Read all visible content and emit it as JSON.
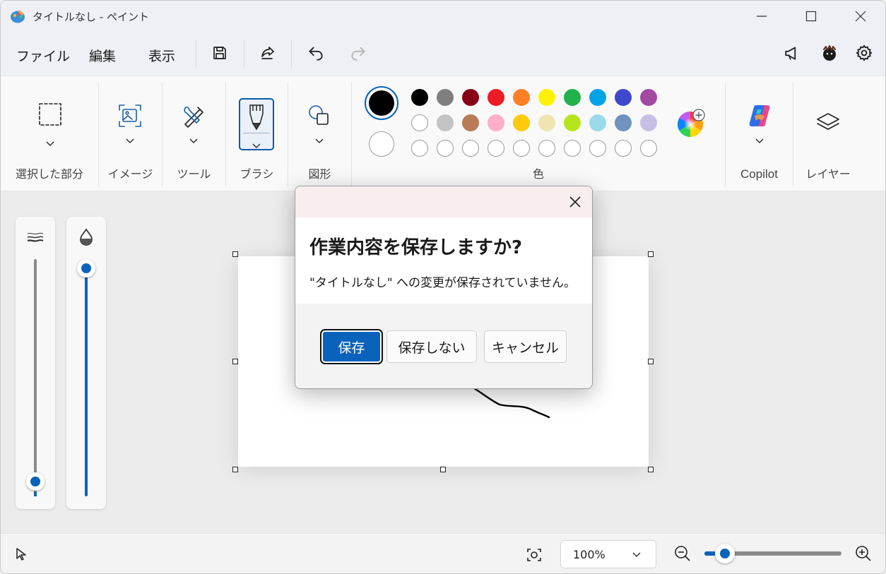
{
  "window": {
    "title": "タイトルなし - ペイント"
  },
  "menu": {
    "file": "ファイル",
    "edit": "編集",
    "view": "表示"
  },
  "ribbon": {
    "selection_label": "選択した部分",
    "image_label": "イメージ",
    "tools_label": "ツール",
    "brush_label": "ブラシ",
    "shapes_label": "図形",
    "colors_label": "色",
    "copilot_label": "Copilot",
    "layers_label": "レイヤー"
  },
  "colors": {
    "primary": "#000000",
    "secondary": "#ffffff",
    "row1": [
      "#000000",
      "#7f7f7f",
      "#880015",
      "#ed1c24",
      "#ff7f27",
      "#fff200",
      "#22b14c",
      "#00a2e8",
      "#3f48cc",
      "#a349a4"
    ],
    "row2": [
      "#ffffff",
      "#c3c3c3",
      "#b97a57",
      "#ffaec9",
      "#ffc90e",
      "#efe4b0",
      "#b5e61d",
      "#99d9ea",
      "#7092be",
      "#c8bfe7"
    ],
    "accent": "#0a63bb"
  },
  "sliders": {
    "size_level": 0.0,
    "opacity_level": 1.0
  },
  "dialog": {
    "title": "作業内容を保存しますか?",
    "message": "\"タイトルなし\" への変更が保存されていません。",
    "save_label": "保存",
    "dont_save_label": "保存しない",
    "cancel_label": "キャンセル"
  },
  "status": {
    "zoom": "100%",
    "zoom_slider_level": 0.15
  },
  "icons": [
    "paint-app-icon",
    "save-icon",
    "share-icon",
    "undo-icon",
    "redo-icon",
    "megaphone-icon",
    "avatar-icon",
    "gear-icon",
    "selection-icon",
    "image-icon",
    "tools-icon",
    "brush-icon",
    "shapes-icon",
    "color-picker-icon",
    "copilot-icon",
    "layers-icon",
    "close-icon",
    "zoom-out-icon",
    "zoom-in-icon",
    "fit-screen-icon",
    "cursor-icon"
  ]
}
